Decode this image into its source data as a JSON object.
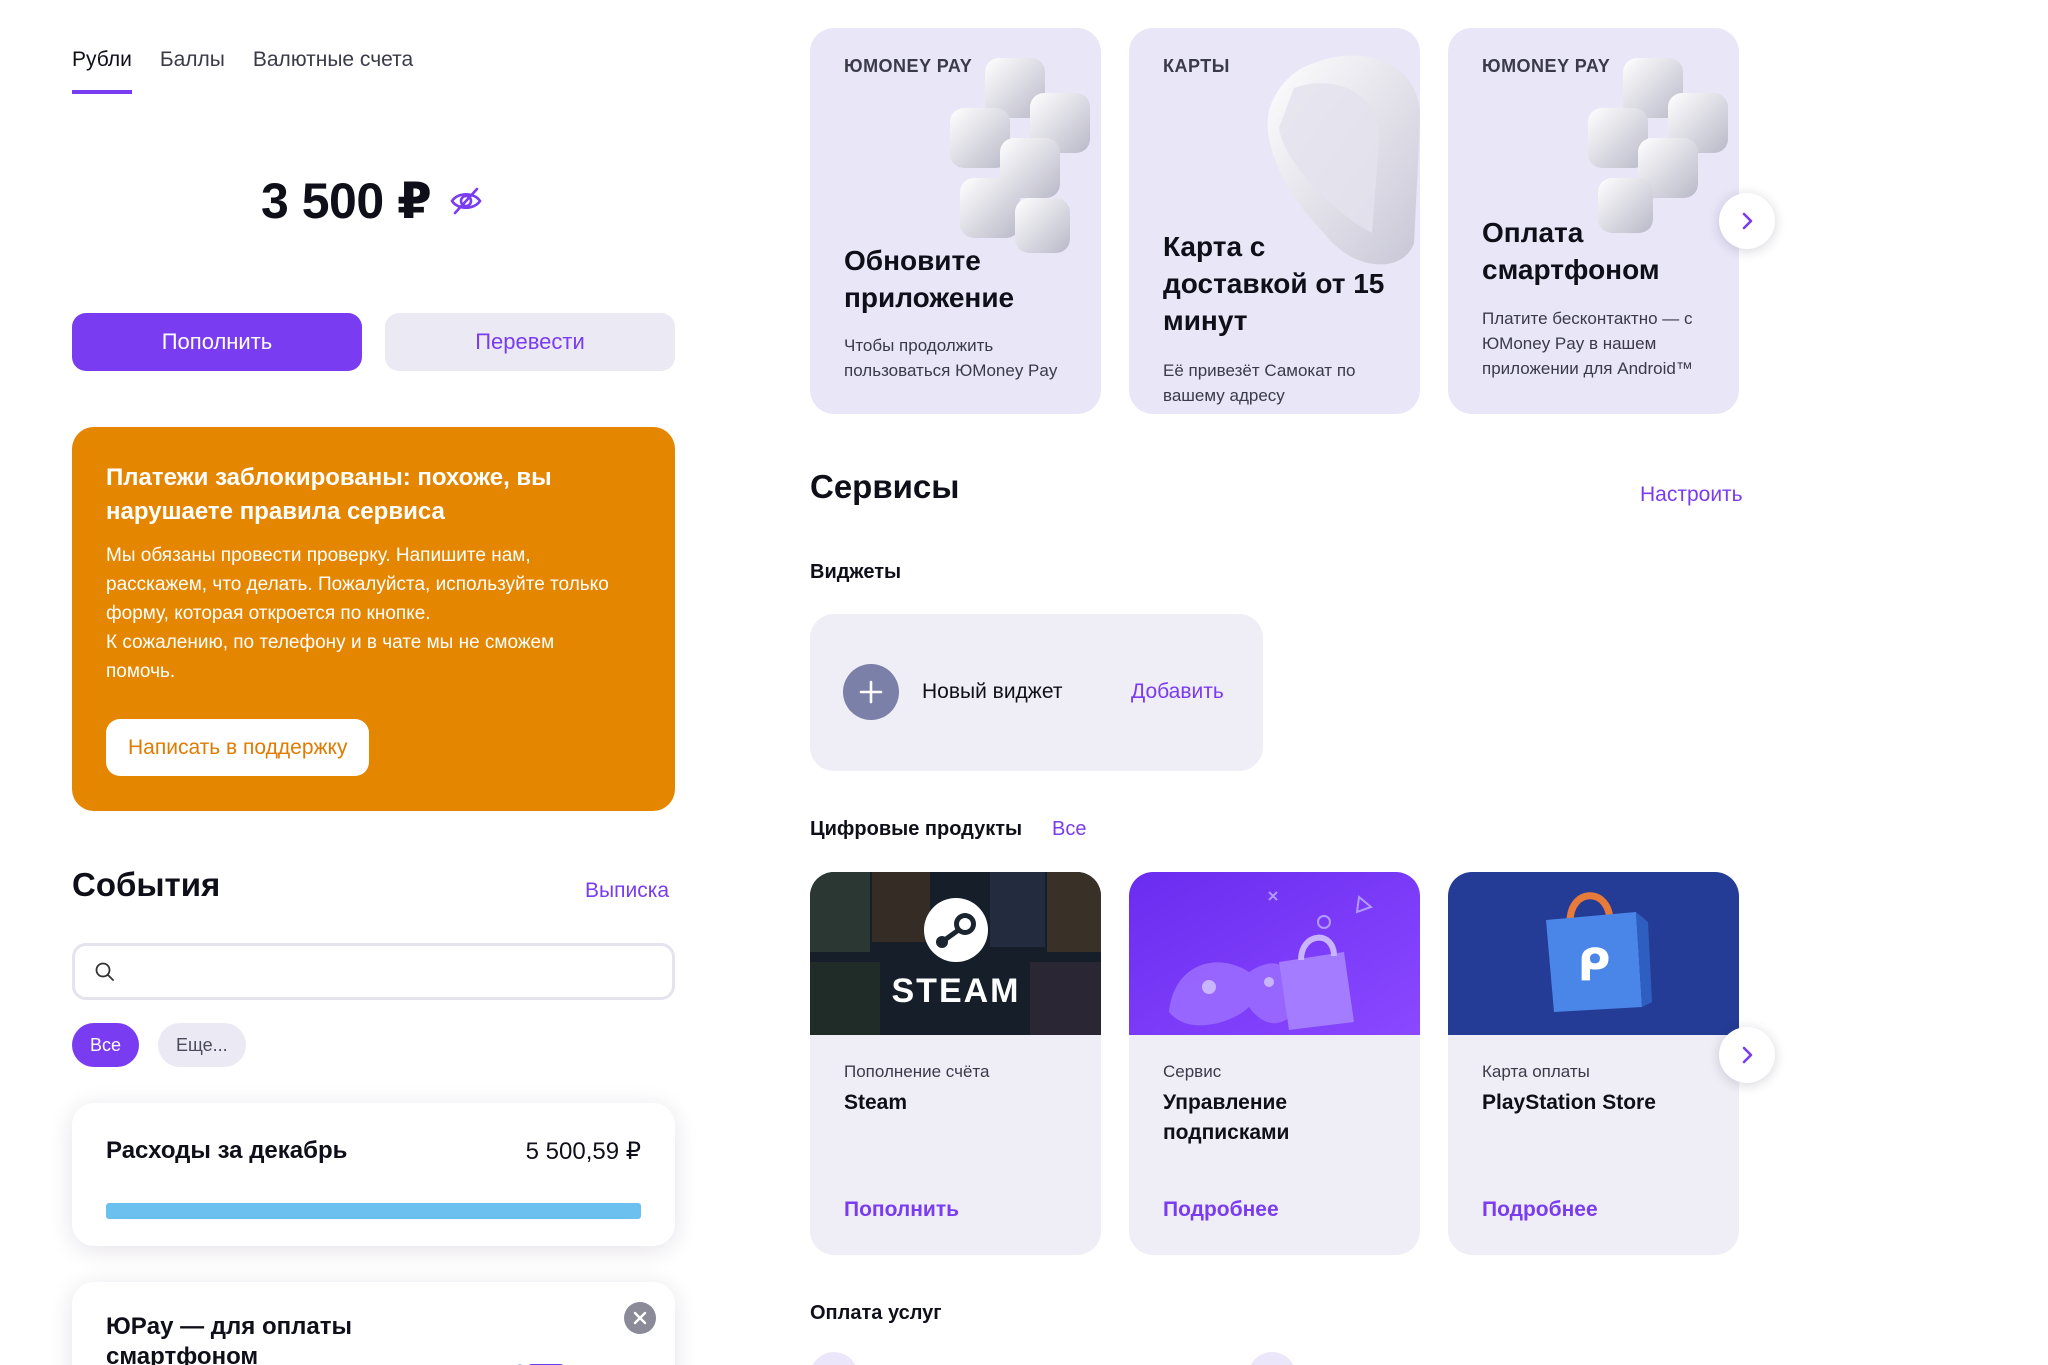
{
  "accent": "#7a3cf0",
  "tabs": [
    "Рубли",
    "Баллы",
    "Валютные счета"
  ],
  "balance": {
    "amount": "3 500 ₽",
    "visibility_icon": "eye-crossed-icon"
  },
  "actions": {
    "topup": "Пополнить",
    "transfer": "Перевести"
  },
  "alert": {
    "color": "#e58600",
    "title": "Платежи заблокированы: похоже, вы нарушаете правила сервиса",
    "text": "Мы обязаны провести проверку. Напишите нам, расскажем, что делать. Пожалуйста, используйте только форму, которая откроется по кнопке.\nК сожалению, по телефону и в чате мы не сможем помочь.",
    "button": "Написать в поддержку"
  },
  "events": {
    "title": "События",
    "statement_link": "Выписка",
    "search_placeholder": "",
    "filters": [
      "Все",
      "Еще..."
    ],
    "expenses": {
      "title": "Расходы за декабрь",
      "amount": "5 500,59 ₽",
      "bar_fill": 1.0,
      "bar_color": "#6bc0f0"
    },
    "promo": {
      "title": "ЮPay — для оплаты смартфоном"
    }
  },
  "promo_cards": [
    {
      "category": "ЮMONEY PAY",
      "title": "Обновите приложение",
      "text": "Чтобы продолжить пользоваться ЮMoney Pay"
    },
    {
      "category": "КАРТЫ",
      "title": "Карта с доставкой от 15 минут",
      "text": "Её привезёт Самокат по вашему адресу"
    },
    {
      "category": "ЮMONEY PAY",
      "title": "Оплата смартфоном",
      "text": "Платите бесконтактно — с ЮMoney Pay в нашем приложении для Android™"
    }
  ],
  "services": {
    "title": "Сервисы",
    "configure_link": "Настроить",
    "widgets_label": "Виджеты",
    "widget": {
      "name": "Новый виджет",
      "add": "Добавить"
    },
    "digital_label": "Цифровые продукты",
    "digital_all": "Все",
    "digital_products": [
      {
        "category": "Пополнение счёта",
        "title": "Steam",
        "link": "Пополнить",
        "image_text": "STEAM"
      },
      {
        "category": "Сервис",
        "title": "Управление подписками",
        "link": "Подробнее"
      },
      {
        "category": "Карта оплаты",
        "title": "PlayStation Store",
        "link": "Подробнее"
      }
    ],
    "payments_label": "Оплата услуг"
  }
}
